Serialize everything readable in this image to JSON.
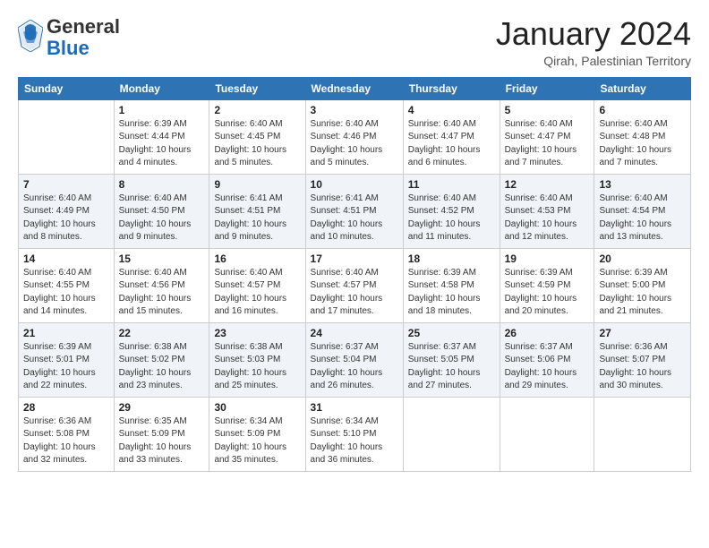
{
  "logo": {
    "general": "General",
    "blue": "Blue"
  },
  "title": "January 2024",
  "location": "Qirah, Palestinian Territory",
  "headers": [
    "Sunday",
    "Monday",
    "Tuesday",
    "Wednesday",
    "Thursday",
    "Friday",
    "Saturday"
  ],
  "weeks": [
    [
      {
        "day": "",
        "info": ""
      },
      {
        "day": "1",
        "info": "Sunrise: 6:39 AM\nSunset: 4:44 PM\nDaylight: 10 hours\nand 4 minutes."
      },
      {
        "day": "2",
        "info": "Sunrise: 6:40 AM\nSunset: 4:45 PM\nDaylight: 10 hours\nand 5 minutes."
      },
      {
        "day": "3",
        "info": "Sunrise: 6:40 AM\nSunset: 4:46 PM\nDaylight: 10 hours\nand 5 minutes."
      },
      {
        "day": "4",
        "info": "Sunrise: 6:40 AM\nSunset: 4:47 PM\nDaylight: 10 hours\nand 6 minutes."
      },
      {
        "day": "5",
        "info": "Sunrise: 6:40 AM\nSunset: 4:47 PM\nDaylight: 10 hours\nand 7 minutes."
      },
      {
        "day": "6",
        "info": "Sunrise: 6:40 AM\nSunset: 4:48 PM\nDaylight: 10 hours\nand 7 minutes."
      }
    ],
    [
      {
        "day": "7",
        "info": "Sunrise: 6:40 AM\nSunset: 4:49 PM\nDaylight: 10 hours\nand 8 minutes."
      },
      {
        "day": "8",
        "info": "Sunrise: 6:40 AM\nSunset: 4:50 PM\nDaylight: 10 hours\nand 9 minutes."
      },
      {
        "day": "9",
        "info": "Sunrise: 6:41 AM\nSunset: 4:51 PM\nDaylight: 10 hours\nand 9 minutes."
      },
      {
        "day": "10",
        "info": "Sunrise: 6:41 AM\nSunset: 4:51 PM\nDaylight: 10 hours\nand 10 minutes."
      },
      {
        "day": "11",
        "info": "Sunrise: 6:40 AM\nSunset: 4:52 PM\nDaylight: 10 hours\nand 11 minutes."
      },
      {
        "day": "12",
        "info": "Sunrise: 6:40 AM\nSunset: 4:53 PM\nDaylight: 10 hours\nand 12 minutes."
      },
      {
        "day": "13",
        "info": "Sunrise: 6:40 AM\nSunset: 4:54 PM\nDaylight: 10 hours\nand 13 minutes."
      }
    ],
    [
      {
        "day": "14",
        "info": "Sunrise: 6:40 AM\nSunset: 4:55 PM\nDaylight: 10 hours\nand 14 minutes."
      },
      {
        "day": "15",
        "info": "Sunrise: 6:40 AM\nSunset: 4:56 PM\nDaylight: 10 hours\nand 15 minutes."
      },
      {
        "day": "16",
        "info": "Sunrise: 6:40 AM\nSunset: 4:57 PM\nDaylight: 10 hours\nand 16 minutes."
      },
      {
        "day": "17",
        "info": "Sunrise: 6:40 AM\nSunset: 4:57 PM\nDaylight: 10 hours\nand 17 minutes."
      },
      {
        "day": "18",
        "info": "Sunrise: 6:39 AM\nSunset: 4:58 PM\nDaylight: 10 hours\nand 18 minutes."
      },
      {
        "day": "19",
        "info": "Sunrise: 6:39 AM\nSunset: 4:59 PM\nDaylight: 10 hours\nand 20 minutes."
      },
      {
        "day": "20",
        "info": "Sunrise: 6:39 AM\nSunset: 5:00 PM\nDaylight: 10 hours\nand 21 minutes."
      }
    ],
    [
      {
        "day": "21",
        "info": "Sunrise: 6:39 AM\nSunset: 5:01 PM\nDaylight: 10 hours\nand 22 minutes."
      },
      {
        "day": "22",
        "info": "Sunrise: 6:38 AM\nSunset: 5:02 PM\nDaylight: 10 hours\nand 23 minutes."
      },
      {
        "day": "23",
        "info": "Sunrise: 6:38 AM\nSunset: 5:03 PM\nDaylight: 10 hours\nand 25 minutes."
      },
      {
        "day": "24",
        "info": "Sunrise: 6:37 AM\nSunset: 5:04 PM\nDaylight: 10 hours\nand 26 minutes."
      },
      {
        "day": "25",
        "info": "Sunrise: 6:37 AM\nSunset: 5:05 PM\nDaylight: 10 hours\nand 27 minutes."
      },
      {
        "day": "26",
        "info": "Sunrise: 6:37 AM\nSunset: 5:06 PM\nDaylight: 10 hours\nand 29 minutes."
      },
      {
        "day": "27",
        "info": "Sunrise: 6:36 AM\nSunset: 5:07 PM\nDaylight: 10 hours\nand 30 minutes."
      }
    ],
    [
      {
        "day": "28",
        "info": "Sunrise: 6:36 AM\nSunset: 5:08 PM\nDaylight: 10 hours\nand 32 minutes."
      },
      {
        "day": "29",
        "info": "Sunrise: 6:35 AM\nSunset: 5:09 PM\nDaylight: 10 hours\nand 33 minutes."
      },
      {
        "day": "30",
        "info": "Sunrise: 6:34 AM\nSunset: 5:09 PM\nDaylight: 10 hours\nand 35 minutes."
      },
      {
        "day": "31",
        "info": "Sunrise: 6:34 AM\nSunset: 5:10 PM\nDaylight: 10 hours\nand 36 minutes."
      },
      {
        "day": "",
        "info": ""
      },
      {
        "day": "",
        "info": ""
      },
      {
        "day": "",
        "info": ""
      }
    ]
  ]
}
